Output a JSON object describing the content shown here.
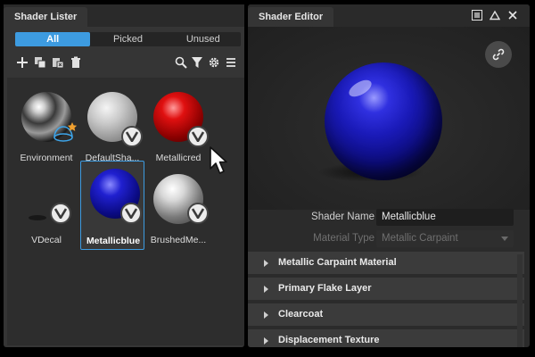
{
  "lister": {
    "title": "Shader Lister",
    "filters": [
      {
        "label": "All",
        "active": true
      },
      {
        "label": "Picked",
        "active": false
      },
      {
        "label": "Unused",
        "active": false
      }
    ],
    "toolbar_icons": [
      "add-icon",
      "duplicate-icon",
      "copy-delete-icon",
      "trash-icon",
      "search-icon",
      "filter-icon",
      "settings-icon",
      "menu-icon"
    ],
    "shaders": [
      {
        "label": "Environment",
        "material": "chrome",
        "badge": "none",
        "selected": false
      },
      {
        "label": "DefaultSha...",
        "material": "white",
        "badge": "V",
        "selected": false
      },
      {
        "label": "Metallicred",
        "material": "red",
        "badge": "V",
        "selected": false
      },
      {
        "label": "VDecal",
        "material": "decal",
        "badge": "V",
        "selected": false
      },
      {
        "label": "Metallicblue",
        "material": "blue",
        "badge": "V",
        "selected": true
      },
      {
        "label": "BrushedMe...",
        "material": "silver",
        "badge": "V",
        "selected": false
      }
    ]
  },
  "editor": {
    "title": "Shader Editor",
    "window_icons": [
      "menu-icon",
      "maximize-icon",
      "close-icon"
    ],
    "properties": [
      {
        "label": "Shader Name",
        "value": "Metallicblue",
        "enabled": true
      },
      {
        "label": "Material Type",
        "value": "Metallic Carpaint",
        "enabled": false
      }
    ],
    "sections": [
      {
        "label": "Metallic Carpaint Material"
      },
      {
        "label": "Primary Flake Layer"
      },
      {
        "label": "Clearcoat"
      },
      {
        "label": "Displacement Texture"
      }
    ]
  },
  "colors": {
    "accent": "#3d9be0",
    "preview_ball": "#1c1cc8",
    "linked_badge": "#7fbf5a"
  }
}
